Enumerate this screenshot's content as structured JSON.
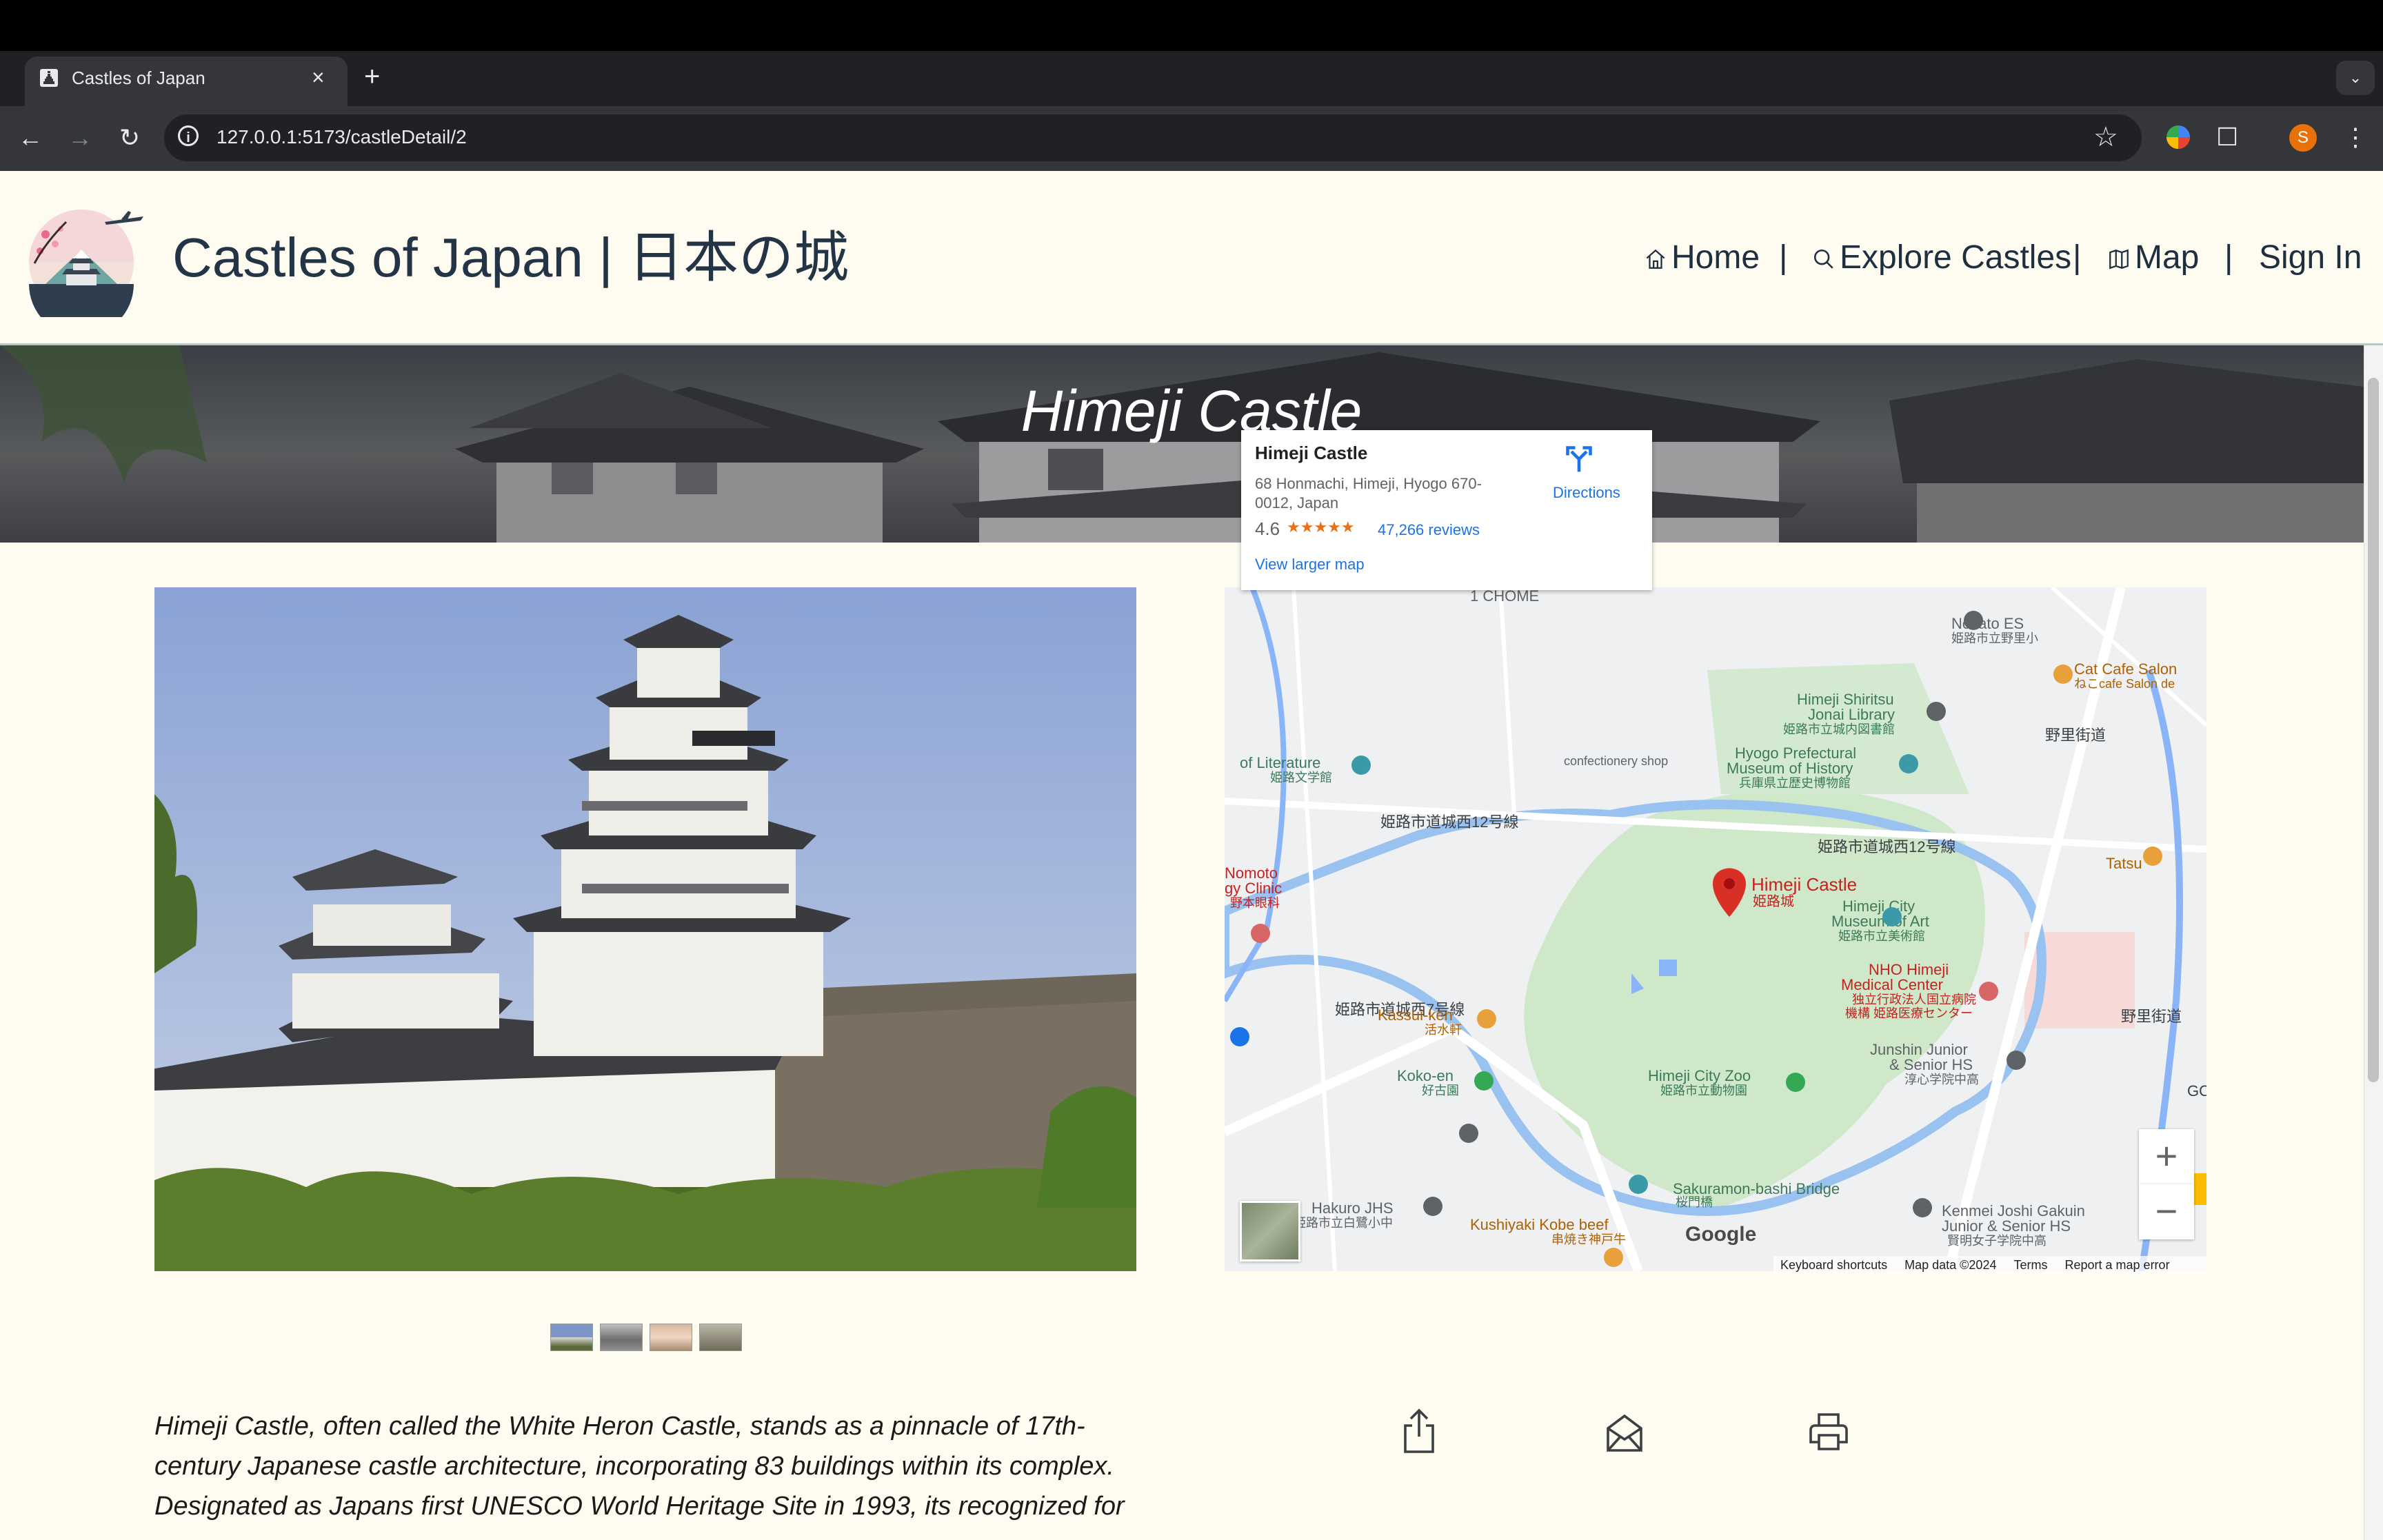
{
  "browser": {
    "tab_title": "Castles of Japan",
    "tab_close": "×",
    "new_tab": "+",
    "url": "127.0.0.1:5173/castleDetail/2",
    "profile_initial": "S"
  },
  "site": {
    "title": "Castles of Japan | 日本の城",
    "nav": {
      "home": "Home",
      "separator": "|",
      "explore": "Explore Castles",
      "map": "Map",
      "sign_in": "Sign In"
    }
  },
  "castle": {
    "name": "Himeji Castle",
    "description": "Himeji Castle, often called the White Heron Castle, stands as a pinnacle of 17th-century Japanese castle architecture, incorporating 83 buildings within its complex. Designated as Japans first UNESCO World Heritage Site in 1993, its recognized for"
  },
  "map": {
    "place_name": "Himeji Castle",
    "address": "68 Honmachi, Himeji, Hyogo 670-0012, Japan",
    "rating": "4.6",
    "stars": "★★★★★",
    "reviews": "47,266 reviews",
    "larger_map": "View larger map",
    "directions": "Directions",
    "zoom_in": "+",
    "zoom_out": "−",
    "google": "Google",
    "footer": {
      "shortcuts": "Keyboard shortcuts",
      "data": "Map data ©2024",
      "terms": "Terms",
      "report": "Report a map error"
    },
    "labels": [
      "1 CHOME",
      "Nozato ES",
      "姫路市立野里小",
      "Cat Cafe Salon",
      "ねこcafe Salon de",
      "Himeji Shiritsu",
      "Jonai Library",
      "姫路市立城内図書館",
      "野里街道",
      "Hyogo Prefectural",
      "Museum of History",
      "兵庫県立歴史博物館",
      "confectionery shop",
      "of Literature",
      "姫路文学館",
      "姫路市道城西12号線",
      "姫路市道城西12号線",
      "Tatsu",
      "Nomoto",
      "gy Clinic",
      "野本眼科",
      "Himeji Castle",
      "姫路城",
      "Himeji City",
      "Museum of Art",
      "姫路市立美術館",
      "姫路市道城西7号線",
      "NHO Himeji",
      "Medical Center",
      "独立行政法人国立病院",
      "機構 姫路医療センター",
      "Kassui-ken",
      "活水軒",
      "野里街道",
      "Junshin Junior",
      "& Senior HS",
      "淳心学院中高",
      "Koko-en",
      "好古園",
      "Himeji City Zoo",
      "姫路市立動物園",
      "GO",
      "Hakuro JHS",
      "姫路市立白鷺小中",
      "Sakuramon-bashi Bridge",
      "桜門橋",
      "Kenmei Joshi Gakuin",
      "Junior & Senior HS",
      "賢明女子学院中高",
      "Kushiyaki Kobe beef",
      "串焼き神戸牛"
    ]
  },
  "colors": {
    "page_bg": "#fefcf0",
    "heading": "#243447",
    "map_blue": "#1a73e8",
    "pin_red": "#d93025"
  }
}
